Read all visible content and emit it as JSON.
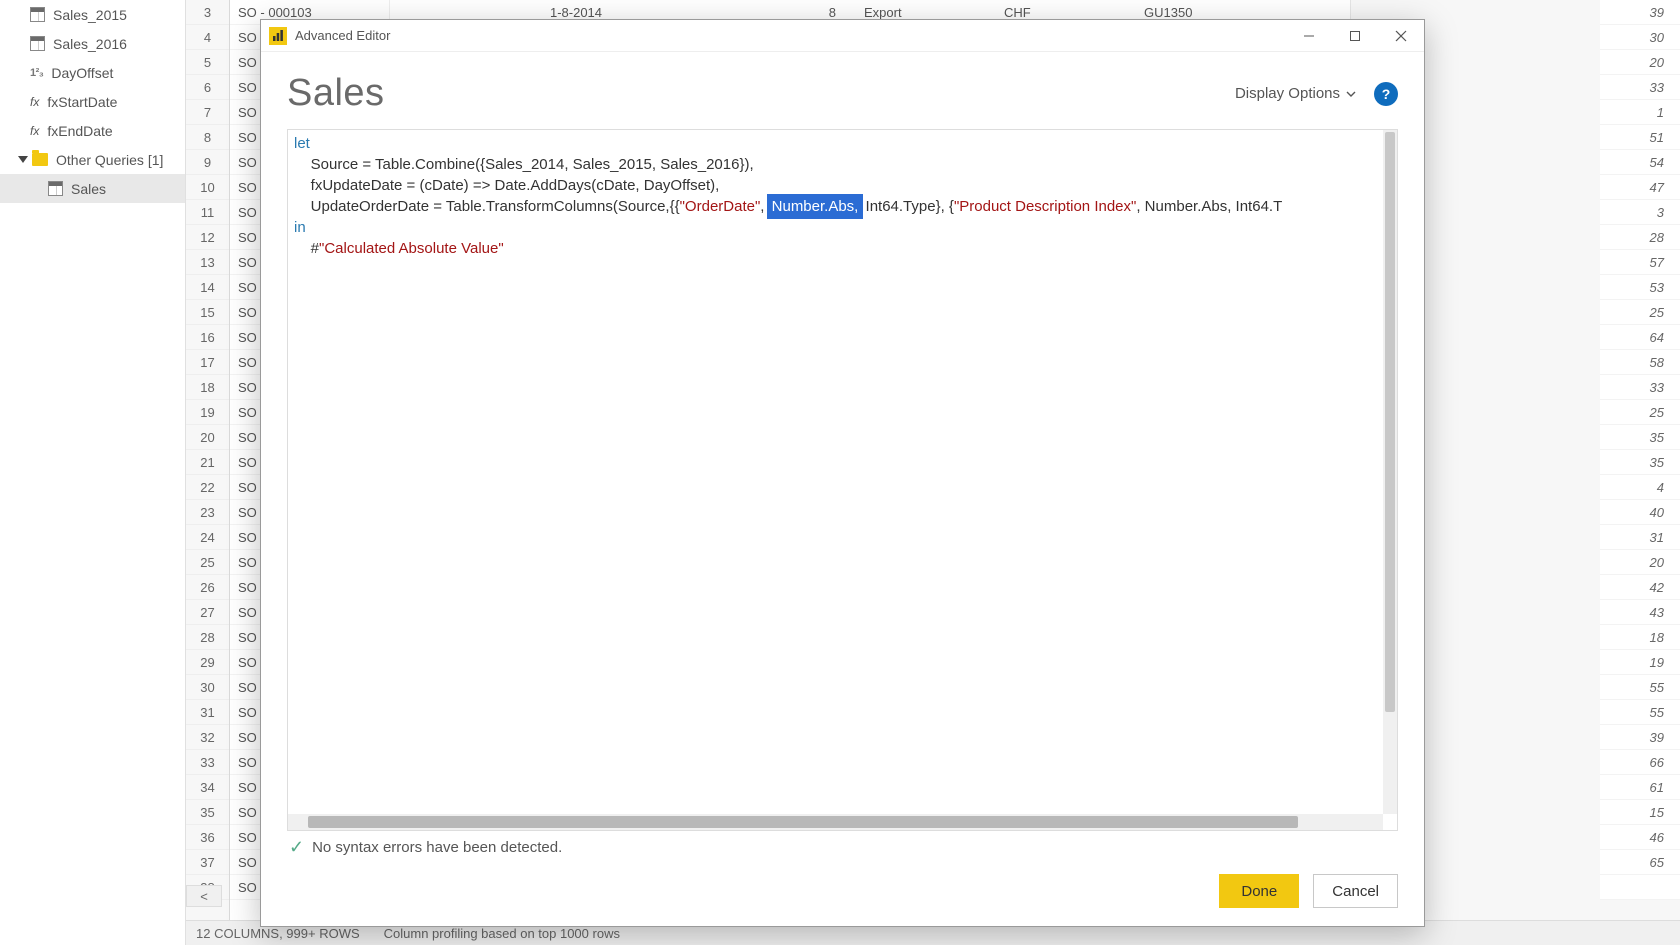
{
  "tree": {
    "items": [
      {
        "label": "Sales_2015",
        "type": "table"
      },
      {
        "label": "Sales_2016",
        "type": "table"
      },
      {
        "label": "DayOffset",
        "type": "num",
        "prefix": "1²₃"
      },
      {
        "label": "fxStartDate",
        "type": "fx"
      },
      {
        "label": "fxEndDate",
        "type": "fx"
      }
    ],
    "group_label": "Other Queries [1]",
    "selected_label": "Sales"
  },
  "grid": {
    "row_start": 3,
    "row_end": 38,
    "so_prefix": "SO - ",
    "first_row": {
      "so": "SO - 000103",
      "date": "1-8-2014",
      "qty": "8",
      "channel": "Export",
      "curr": "CHF",
      "code": "GU1350"
    },
    "right_values": [
      39,
      30,
      20,
      33,
      1,
      51,
      54,
      47,
      3,
      28,
      57,
      53,
      25,
      64,
      58,
      33,
      25,
      35,
      35,
      4,
      40,
      31,
      20,
      42,
      43,
      18,
      19,
      55,
      55,
      39,
      66,
      61,
      15,
      46,
      65
    ]
  },
  "statusbar": {
    "left": "12 COLUMNS, 999+ ROWS",
    "right": "Column profiling based on top 1000 rows"
  },
  "dialog": {
    "title": "Advanced Editor",
    "query_name": "Sales",
    "display_options": "Display Options",
    "code": {
      "l1_let": "let",
      "l2": "    Source = Table.Combine({Sales_2014, Sales_2015, Sales_2016}),",
      "l3": "    fxUpdateDate = (cDate) => Date.AddDays(cDate, DayOffset),",
      "l4_pre": "    UpdateOrderDate = Table.TransformColumns(Source,{{",
      "l4_s1": "\"OrderDate\"",
      "l4_mid1": ", ",
      "l4_sel": "Number.Abs,",
      "l4_mid2": " Int64.Type}, {",
      "l4_s2": "\"Product Description Index\"",
      "l4_post": ", Number.Abs, Int64.T",
      "l5_in": "in",
      "l6_pre": "    #",
      "l6_str": "\"Calculated Absolute Value\""
    },
    "syntax_msg": "No syntax errors have been detected.",
    "done": "Done",
    "cancel": "Cancel"
  }
}
